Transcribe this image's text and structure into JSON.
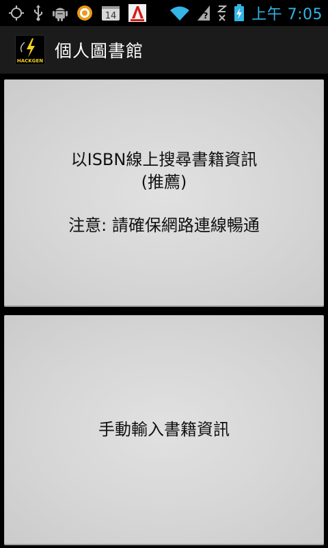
{
  "status_bar": {
    "time": "上午 7:05",
    "notification_badge": "14",
    "icons": [
      "gps-icon",
      "usb-icon",
      "android-debug-icon",
      "sync-ring-icon",
      "calendar-icon",
      "app-notification-icon",
      "wifi-icon",
      "signal-unknown-icon",
      "no-data-icon",
      "battery-charging-icon"
    ],
    "time_color": "#33b5e5"
  },
  "action_bar": {
    "title": "個人圖書館",
    "logo_text": "HACKGEN"
  },
  "main": {
    "isbn_button": {
      "line1": "以ISBN線上搜尋書籍資訊",
      "line2": "(推薦)",
      "note": "注意: 請確保網路連線暢通"
    },
    "manual_button": {
      "label": "手動輸入書籍資訊"
    }
  }
}
